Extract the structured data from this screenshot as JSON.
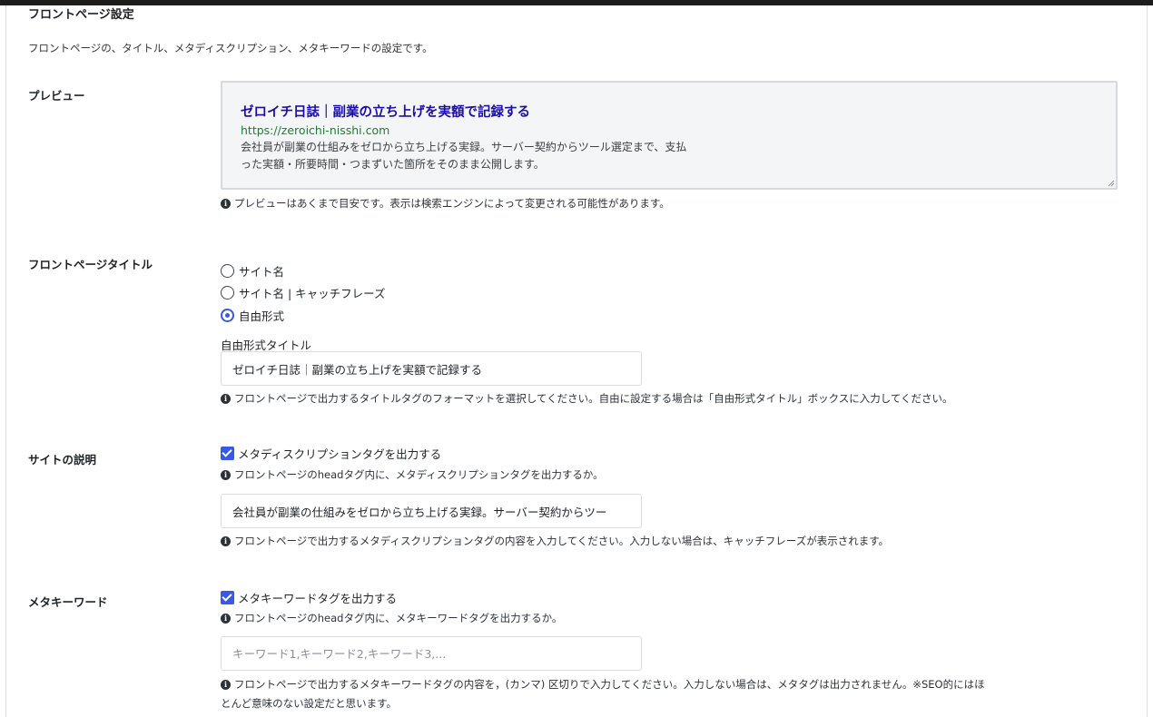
{
  "section": {
    "title": "フロントページ設定",
    "description": "フロントページの、タイトル、メタディスクリプション、メタキーワードの設定です。"
  },
  "preview": {
    "label": "プレビュー",
    "title": "ゼロイチ日誌｜副業の立ち上げを実額で記録する",
    "url": "https://zeroichi-nisshi.com",
    "description_line1": "会社員が副業の仕組みをゼロから立ち上げる実録。サーバー契約からツール選定まで、支払",
    "description_line2": "った実額・所要時間・つまずいた箇所をそのまま公開します。",
    "note": "プレビューはあくまで目安です。表示は検索エンジンによって変更される可能性があります。"
  },
  "front_title": {
    "label": "フロントページタイトル",
    "options": [
      {
        "label": "サイト名",
        "checked": false
      },
      {
        "label": "サイト名 | キャッチフレーズ",
        "checked": false
      },
      {
        "label": "自由形式",
        "checked": true
      }
    ],
    "freeform_label": "自由形式タイトル",
    "freeform_value": "ゼロイチ日誌｜副業の立ち上げを実額で記録する",
    "note": "フロントページで出力するタイトルタグのフォーマットを選択してください。自由に設定する場合は「自由形式タイトル」ボックスに入力してください。"
  },
  "site_description": {
    "label": "サイトの説明",
    "checkbox_label": "メタディスクリプションタグを出力する",
    "checked": true,
    "sub_note": "フロントページのheadタグ内に、メタディスクリプションタグを出力するか。",
    "value": "会社員が副業の仕組みをゼロから立ち上げる実録。サーバー契約からツー",
    "note": "フロントページで出力するメタディスクリプションタグの内容を入力してください。入力しない場合は、キャッチフレーズが表示されます。"
  },
  "meta_keywords": {
    "label": "メタキーワード",
    "checkbox_label": "メタキーワードタグを出力する",
    "checked": true,
    "sub_note": "フロントページのheadタグ内に、メタキーワードタグを出力するか。",
    "placeholder": "キーワード1,キーワード2,キーワード3,...",
    "value": "",
    "note_line1": "フロントページで出力するメタキーワードタグの内容を，(カンマ) 区切りで入力してください。入力しない場合は、メタタグは出力されません。※SEO的にはほ",
    "note_line2": "とんど意味のない設定だと思います。"
  },
  "colors": {
    "accent": "#3858e9",
    "preview_title": "#1a0dab",
    "preview_url": "#1e7d32"
  },
  "icons": [
    "info-icon"
  ]
}
